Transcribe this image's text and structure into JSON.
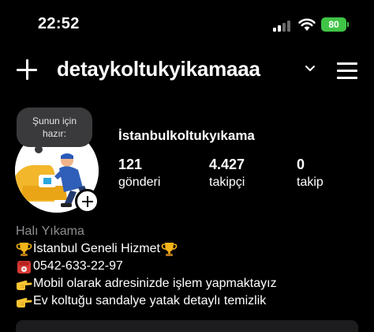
{
  "status_bar": {
    "time": "22:52",
    "battery": "80"
  },
  "header": {
    "username": "detaykoltukyikamaaa"
  },
  "profile": {
    "note": "Şunun için hazır:",
    "display_name": "İstanbulkoltukyıkama",
    "stats": [
      {
        "value": "121",
        "label": "gönderi"
      },
      {
        "value": "4.427",
        "label": "takipçi"
      },
      {
        "value": "0",
        "label": "takip"
      }
    ]
  },
  "bio": {
    "category": "Halı Yıkama",
    "lines": [
      {
        "emoji": "trophy-icon",
        "text": "İstanbul Geneli Hizmet"
      },
      {
        "emoji": "telephone-icon",
        "text": "0542-633-22-97"
      },
      {
        "emoji": "pointing-hand-icon",
        "text": "Mobil olarak adresinizde işlem yapmaktayız"
      },
      {
        "emoji": "pointing-hand-icon",
        "text": "Ev koltuğu sandalye yatak detaylı temizlik"
      }
    ]
  },
  "colors": {
    "battery": "#3fc446",
    "note_bubble": "#3a3a3c",
    "secondary_text": "#8e8e93"
  }
}
